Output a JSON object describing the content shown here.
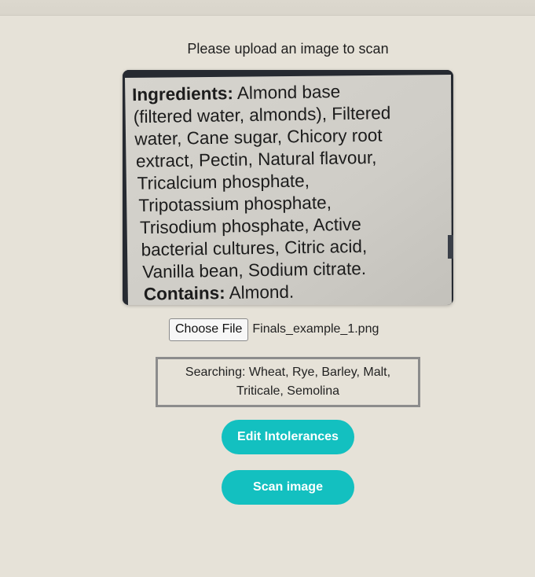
{
  "header": {
    "prompt": "Please upload an image to scan"
  },
  "image": {
    "lines": [
      {
        "bold": "Ingredients:",
        "text": " Almond base"
      },
      {
        "bold": "",
        "text": "(filtered water, almonds), Filtered"
      },
      {
        "bold": "",
        "text": "water, Cane sugar, Chicory root"
      },
      {
        "bold": "",
        "text": "extract, Pectin, Natural flavour,"
      },
      {
        "bold": "",
        "text": "Tricalcium phosphate,"
      },
      {
        "bold": "",
        "text": "Tripotassium phosphate,"
      },
      {
        "bold": "",
        "text": "Trisodium phosphate, Active"
      },
      {
        "bold": "",
        "text": "bacterial cultures, Citric acid,"
      },
      {
        "bold": "",
        "text": "Vanilla bean, Sodium citrate."
      },
      {
        "bold": "Contains:",
        "text": " Almond."
      }
    ]
  },
  "upload": {
    "button_label": "Choose File",
    "file_name": "Finals_example_1.png"
  },
  "search": {
    "text": "Searching: Wheat, Rye, Barley, Malt, Triticale, Semolina"
  },
  "actions": {
    "edit_label": "Edit Intolerances",
    "scan_label": "Scan image"
  },
  "colors": {
    "accent": "#13c0c0",
    "background": "#e6e2d8"
  }
}
